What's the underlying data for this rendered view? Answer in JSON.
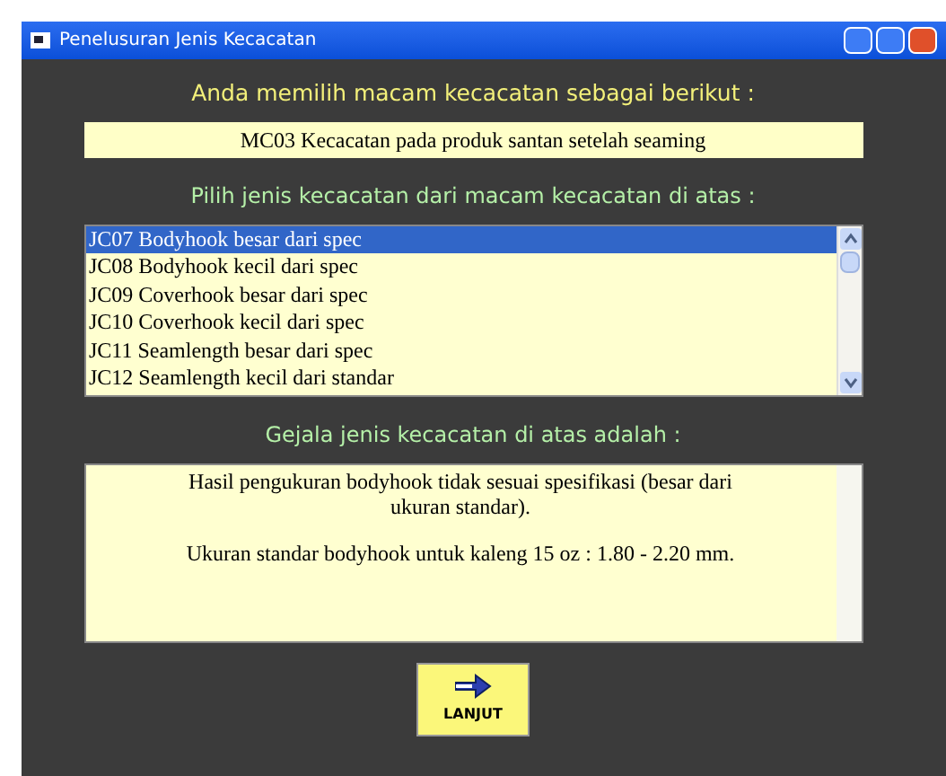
{
  "window": {
    "title": "Penelusuran Jenis Kecacatan"
  },
  "heading_1": "Anda memilih macam kecacatan sebagai berikut :",
  "selected_category": {
    "value": "MC03 Kecacatan pada produk santan setelah seaming"
  },
  "heading_2": "Pilih jenis kecacatan dari macam kecacatan di atas :",
  "defect_list": [
    {
      "label": "JC07 Bodyhook besar dari spec",
      "selected": true
    },
    {
      "label": "JC08 Bodyhook kecil dari spec",
      "selected": false
    },
    {
      "label": "JC09 Coverhook besar dari spec",
      "selected": false
    },
    {
      "label": "JC10 Coverhook kecil dari spec",
      "selected": false
    },
    {
      "label": "JC11 Seamlength besar dari spec",
      "selected": false
    },
    {
      "label": "JC12 Seamlength kecil dari standar",
      "selected": false
    }
  ],
  "heading_3": "Gejala jenis kecacatan di atas adalah :",
  "symptom": {
    "paragraphs": [
      "Hasil pengukuran bodyhook tidak sesuai spesifikasi (besar  dari ukuran standar).",
      "Ukuran standar bodyhook untuk kaleng 15 oz : 1.80 - 2.20 mm."
    ]
  },
  "next_button": {
    "label": "LANJUT"
  }
}
